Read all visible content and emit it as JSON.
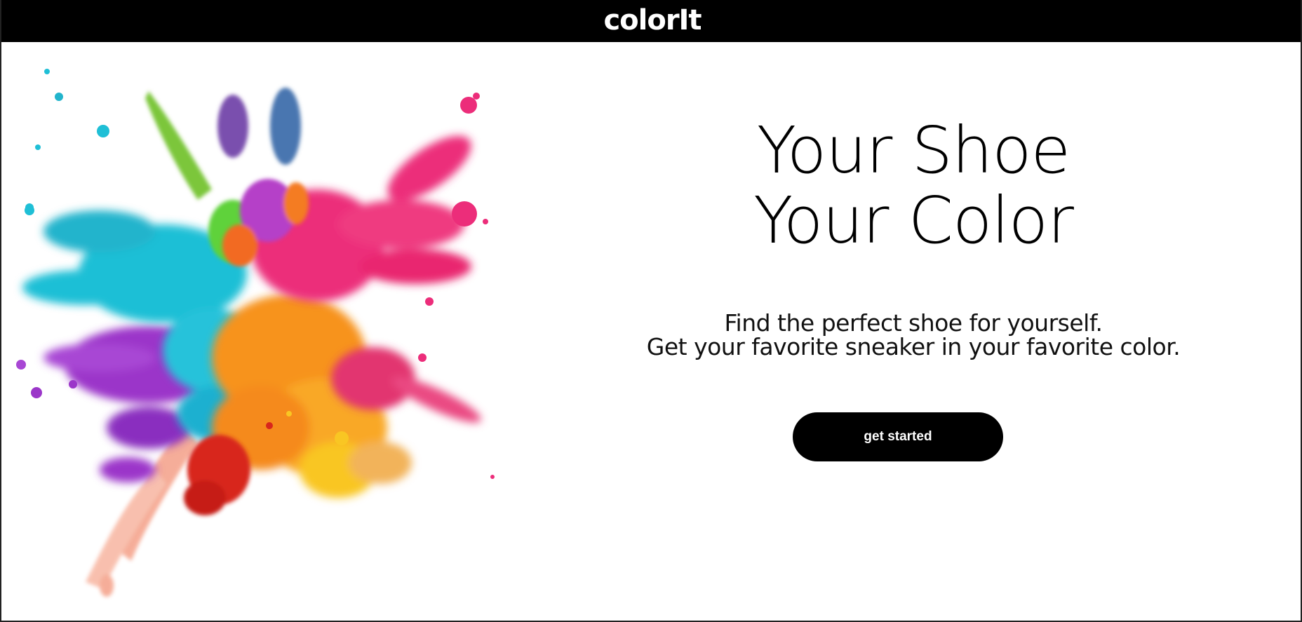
{
  "header": {
    "logo_text": "colorIt",
    "background": "#000000"
  },
  "hero": {
    "headline_line1": "Your Shoe",
    "headline_line2": "Your Color",
    "tagline_line1": "Find the perfect shoe for yourself.",
    "tagline_line2": "Get your favorite sneaker in your favorite color.",
    "cta_label": "get started"
  },
  "colors": {
    "cyan": "#1fbfd6",
    "magenta": "#ec2d7a",
    "purple": "#9b36c9",
    "orange": "#f7931e",
    "yellow": "#f9c623",
    "green": "#7cc63a",
    "red": "#d8261c",
    "peach": "#f5a58e",
    "blue": "#4a76b0"
  }
}
